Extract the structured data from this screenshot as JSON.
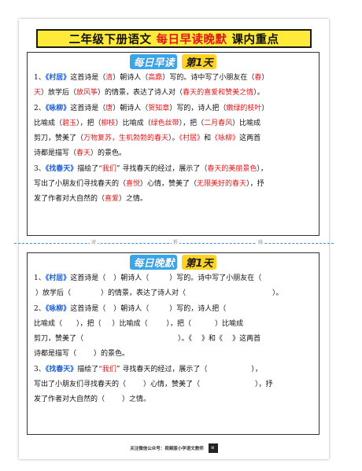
{
  "header": {
    "part1": "二年级下册语文",
    "part2": "每日早读晚默",
    "part3": "课内重点"
  },
  "morning": {
    "head1": "每日早读",
    "head2": "第1天",
    "l1": [
      "1、",
      "《村居》",
      "这首诗是（",
      "清",
      "）朝诗人（",
      "高鼎",
      "）写的。诗中写了小朋友在（",
      "春"
    ],
    "l2": [
      "天",
      "）放学后（",
      "放风筝",
      "）的情景，表达了诗人对（",
      "春天的喜爱和赞美之情",
      "）。"
    ],
    "l3": [
      "2、",
      "《咏柳》",
      "这首诗是（",
      "唐",
      "）朝诗人（",
      "贺知章",
      "）写的，诗人把（",
      "嫩绿的枝叶",
      "）"
    ],
    "l4": [
      "比喻成（",
      "碧玉",
      "），把（",
      "柳枝",
      "）比喻成（",
      "绿色丝带",
      "），把（",
      "二月春风",
      "）比喻成"
    ],
    "l5": [
      "剪刀，赞美了（",
      "万物复苏，生机勃勃的春天",
      "）。",
      "《村居》",
      "和",
      "《咏柳》",
      "这两首"
    ],
    "l6": [
      "诗都是描写（",
      "春天",
      "）的景色。"
    ],
    "l7": [
      "3、",
      "《找春天》",
      "描绘了“",
      "我们",
      "” 寻找春天的经过，展示了（",
      "春天的美丽景色",
      "），"
    ],
    "l8": [
      "写出了小朋友们寻找春天的（",
      "喜悦",
      "）心情，赞美了（",
      "无限美好的春天",
      "），抒"
    ],
    "l9": [
      "发了作者对大自然的（",
      "喜爱",
      "）之情。"
    ]
  },
  "divider": {
    "c1": "对",
    "c2": "折",
    "c3": "线"
  },
  "evening": {
    "head1": "每日晚默",
    "head2": "第1天",
    "l1": [
      "1、",
      "《村居》",
      "这首诗是（",
      "）朝诗人（",
      "）写的。诗中写了小朋友在（"
    ],
    "l2": [
      "）放学后（",
      "）的情景，表达了诗人对（",
      "）。"
    ],
    "l3": [
      "2、",
      "《咏柳》",
      "这首诗是（",
      "）朝诗人（",
      "）写的，诗人把（"
    ],
    "l4": [
      "比喻成（",
      "），把（",
      "）比喻成（",
      "），把（",
      "）比喻成"
    ],
    "l5": [
      "剪刀，赞美了（",
      "）。",
      "《",
      "》和《",
      "》这两首"
    ],
    "l6": [
      "诗都是描写（",
      "）的景色。"
    ],
    "l7": [
      "3、",
      "《找春天》",
      "描绘了“",
      "我们",
      "” 寻找春天的经过，展示了（",
      "），"
    ],
    "l8": [
      "写出了小朋友们寻找春天的（",
      "）心情，赞美了（",
      "），抒"
    ],
    "l9": [
      "发了作者对大自然的（",
      "）之情。"
    ]
  },
  "footer": {
    "text": "关注微信公众号：视频版小学语文教师"
  },
  "colors": {
    "blue": "#1d5fd6",
    "red": "#e0171b",
    "yellow": "#ffea3a",
    "cyan": "#39a6ea"
  }
}
